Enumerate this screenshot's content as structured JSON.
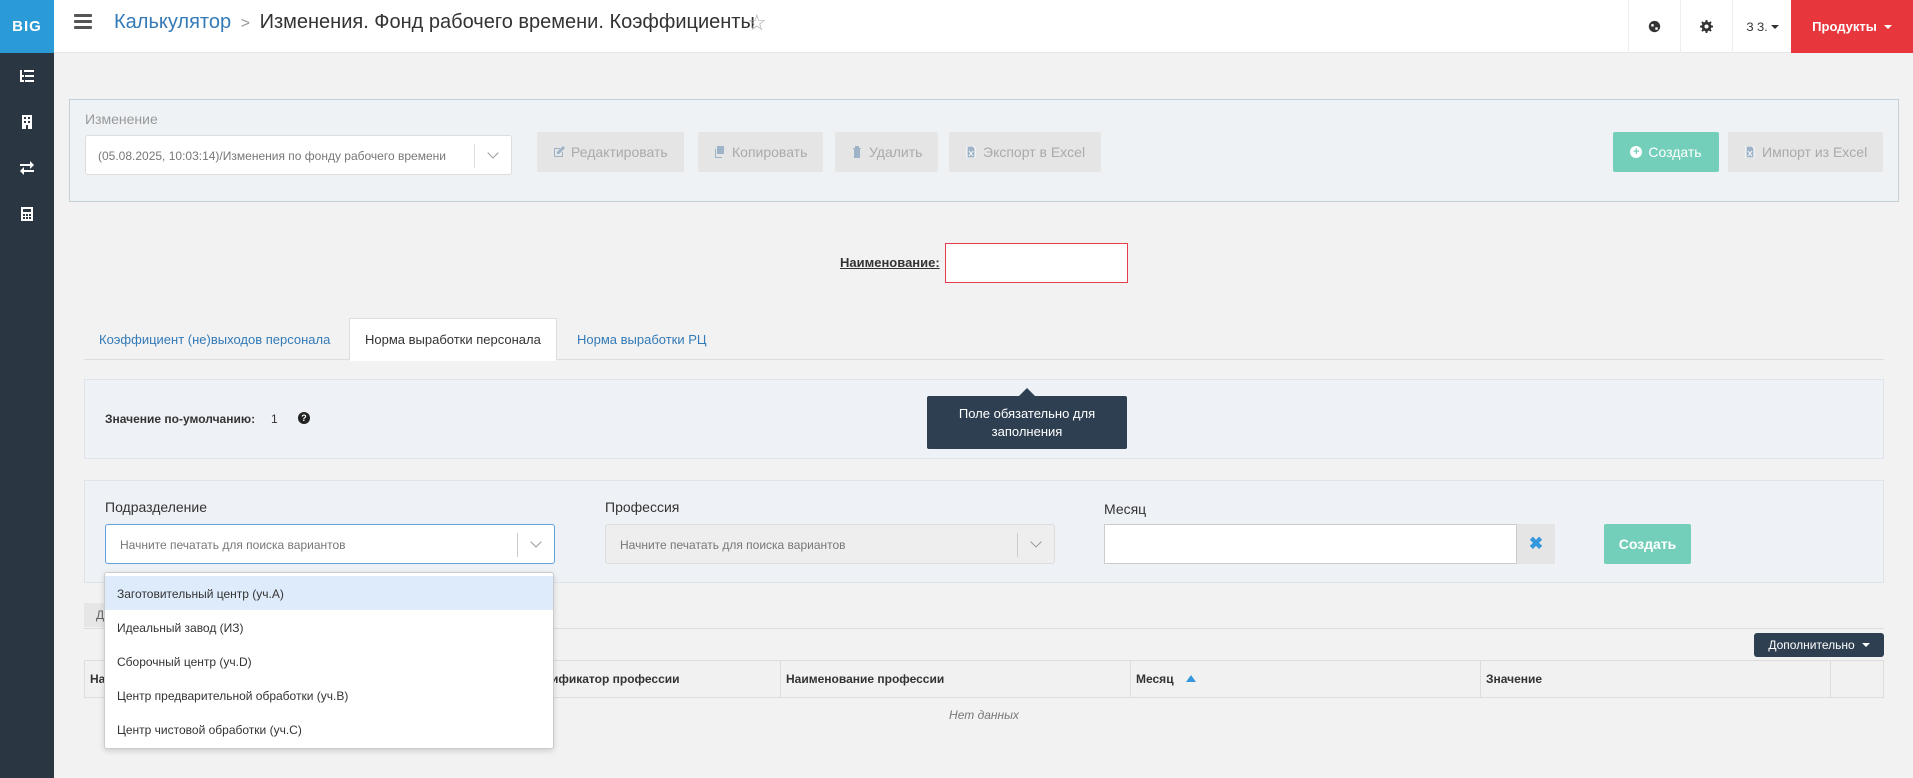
{
  "app": {
    "logo": "BIG"
  },
  "header": {
    "crumb_root": "Калькулятор",
    "crumb_separator": ">",
    "page_title": "Изменения. Фонд рабочего времени. Коэффициенты",
    "user": "З З.",
    "products": "Продукты"
  },
  "change_panel": {
    "label": "Изменение",
    "selected": "(05.08.2025, 10:03:14)/Изменения по фонду рабочего времени",
    "buttons": {
      "edit": "Редактировать",
      "copy": "Копировать",
      "delete": "Удалить",
      "export": "Экспорт в Excel",
      "create": "Создать",
      "import": "Импорт из Excel"
    }
  },
  "name_field": {
    "label": "Наименование:",
    "value": ""
  },
  "tabs": [
    {
      "label": "Коэффициент (не)выходов персонала",
      "active": false
    },
    {
      "label": "Норма выработки персонала",
      "active": true
    },
    {
      "label": "Норма выработки РЦ",
      "active": false
    }
  ],
  "default_value": {
    "label": "Значение по-умолчанию:",
    "value": "1"
  },
  "tooltip": {
    "line1": "Поле обязательно для",
    "line2": "заполнения"
  },
  "filters": {
    "department": {
      "label": "Подразделение",
      "placeholder": "Начните печатать для поиска вариантов"
    },
    "profession": {
      "label": "Профессия",
      "placeholder": "Начните печатать для поиска вариантов"
    },
    "month": {
      "label": "Месяц",
      "value": ""
    },
    "create": "Создать"
  },
  "dropdown": {
    "options": [
      "Заготовительный центр (уч.А)",
      "Идеальный завод (ИЗ)",
      "Сборочный центр (уч.D)",
      "Центр предварительной обработки (уч.B)",
      "Центр чистовой обработки (уч.С)"
    ],
    "highlighted_index": 0
  },
  "grid": {
    "tab_stub": "Д",
    "more_button": "Дополнительно",
    "columns": [
      "На",
      "ификатор профессии",
      "Наименование профессии",
      "Месяц",
      "Значение",
      ""
    ],
    "empty_text": "Нет данных"
  },
  "colors": {
    "sidebar": "#2b3643",
    "logo_bg": "#2a9bd6",
    "products": "#e7363c",
    "create_btn": "#74cfba",
    "tooltip": "#2f3f52",
    "link": "#337ab7",
    "error_border": "#e73d4a"
  }
}
